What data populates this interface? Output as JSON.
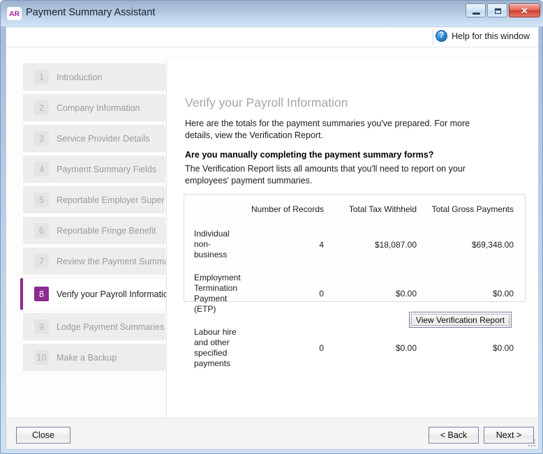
{
  "window": {
    "app_icon_text": "AR",
    "title": "Payment Summary Assistant",
    "minimize_label": "–",
    "maximize_label": "",
    "close_label": "✕"
  },
  "help": {
    "icon": "question-mark-icon",
    "icon_glyph": "?",
    "label": "Help for this window"
  },
  "sidebar": {
    "steps": [
      {
        "num": "1",
        "label": "Introduction",
        "active": false
      },
      {
        "num": "2",
        "label": "Company Information",
        "active": false
      },
      {
        "num": "3",
        "label": "Service Provider Details",
        "active": false
      },
      {
        "num": "4",
        "label": "Payment Summary Fields",
        "active": false
      },
      {
        "num": "5",
        "label": "Reportable Employer Super",
        "active": false
      },
      {
        "num": "6",
        "label": "Reportable Fringe Benefit",
        "active": false
      },
      {
        "num": "7",
        "label": "Review the Payment Summaries",
        "active": false
      },
      {
        "num": "8",
        "label": "Verify your Payroll Information",
        "active": true
      },
      {
        "num": "9",
        "label": "Lodge Payment Summaries",
        "active": false
      },
      {
        "num": "10",
        "label": "Make a Backup",
        "active": false
      }
    ]
  },
  "content": {
    "page_title": "Verify your Payroll Information",
    "intro_paragraph": "Here are the totals for the payment summaries you've prepared. For more details, view the Verification Report.",
    "question_heading": "Are you manually completing the payment summary forms?",
    "question_paragraph": "The Verification Report lists all amounts that you'll need to report on your employees' payment summaries.",
    "verify_button": "View Verification Report"
  },
  "totals_table": {
    "columns": [
      "",
      "Number of Records",
      "Total Tax Withheld",
      "Total Gross Payments"
    ],
    "rows": [
      {
        "label": "Individual non-business",
        "records": "4",
        "tax_withheld": "$18,087.00",
        "gross_payments": "$69,348.00"
      },
      {
        "label": "Employment Termination Payment (ETP)",
        "records": "0",
        "tax_withheld": "$0.00",
        "gross_payments": "$0.00"
      },
      {
        "label": "Labour hire and other specified payments",
        "records": "0",
        "tax_withheld": "$0.00",
        "gross_payments": "$0.00"
      }
    ]
  },
  "footer": {
    "close": "Close",
    "back": "< Back",
    "next": "Next >"
  },
  "colors": {
    "accent_purple": "#8c2a8f",
    "titlebar_blue": "#b9cee4",
    "help_blue": "#2a82c8",
    "close_red": "#cf3f30"
  }
}
